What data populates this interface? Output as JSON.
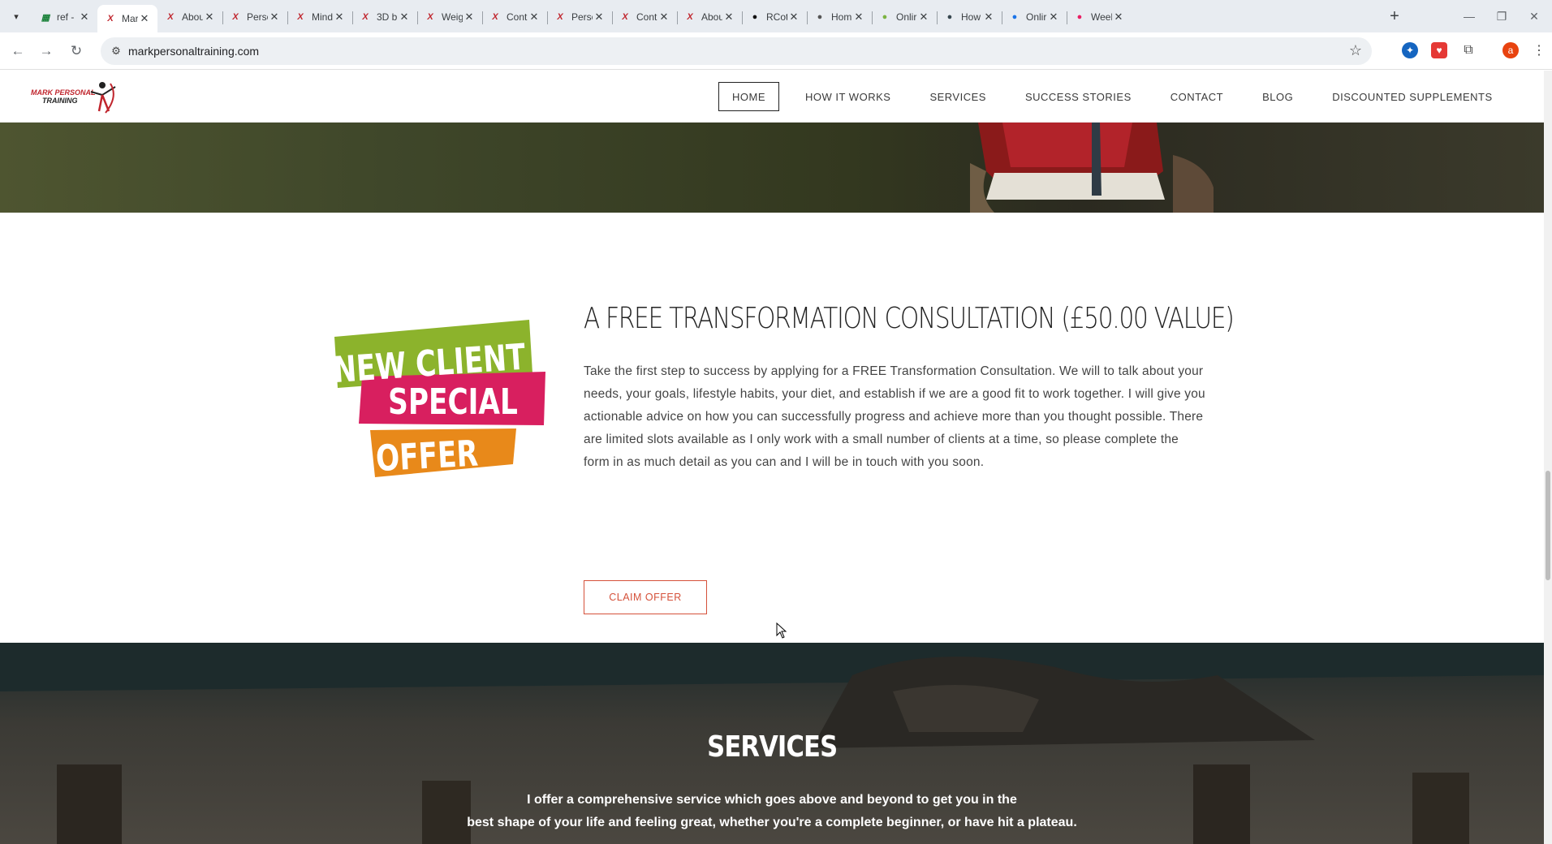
{
  "browser": {
    "tabs": [
      {
        "title": "ref -",
        "favicon": "sheets-icon",
        "color": "#188038",
        "active": false
      },
      {
        "title": "Mark",
        "favicon": "mark-logo-icon",
        "color": "#c0252d",
        "active": true
      },
      {
        "title": "Abou",
        "favicon": "mark-logo-icon",
        "color": "#c0252d",
        "active": false
      },
      {
        "title": "Perso",
        "favicon": "mark-logo-icon",
        "color": "#c0252d",
        "active": false
      },
      {
        "title": "Mind",
        "favicon": "mark-logo-icon",
        "color": "#c0252d",
        "active": false
      },
      {
        "title": "3D b",
        "favicon": "mark-logo-icon",
        "color": "#c0252d",
        "active": false
      },
      {
        "title": "Weig",
        "favicon": "mark-logo-icon",
        "color": "#c0252d",
        "active": false
      },
      {
        "title": "Cont",
        "favicon": "mark-logo-icon",
        "color": "#c0252d",
        "active": false
      },
      {
        "title": "Perso",
        "favicon": "mark-logo-icon",
        "color": "#c0252d",
        "active": false
      },
      {
        "title": "Cont",
        "favicon": "mark-logo-icon",
        "color": "#c0252d",
        "active": false
      },
      {
        "title": "Abou",
        "favicon": "mark-logo-icon",
        "color": "#c0252d",
        "active": false
      },
      {
        "title": "RCot",
        "favicon": "rcot-icon",
        "color": "#111111",
        "active": false
      },
      {
        "title": "Hom",
        "favicon": "home-site-icon",
        "color": "#555555",
        "active": false
      },
      {
        "title": "Onlir",
        "favicon": "online-site-icon",
        "color": "#7cb342",
        "active": false
      },
      {
        "title": "How",
        "favicon": "how-site-icon",
        "color": "#37474f",
        "active": false
      },
      {
        "title": "Onlir",
        "favicon": "p-site-icon",
        "color": "#1a73e8",
        "active": false
      },
      {
        "title": "Weel",
        "favicon": "week-site-icon",
        "color": "#e91e63",
        "active": false
      }
    ],
    "url": "markpersonaltraining.com",
    "profile_initial": "a"
  },
  "site": {
    "logo": {
      "line1": "MARK PERSONAL",
      "line2": "TRAINING"
    },
    "nav": [
      {
        "label": "HOME",
        "active": true
      },
      {
        "label": "HOW IT WORKS",
        "active": false
      },
      {
        "label": "SERVICES",
        "active": false
      },
      {
        "label": "SUCCESS STORIES",
        "active": false
      },
      {
        "label": "CONTACT",
        "active": false
      },
      {
        "label": "BLOG",
        "active": false
      },
      {
        "label": "DISCOUNTED SUPPLEMENTS",
        "active": false
      }
    ],
    "offer": {
      "badge": {
        "line1": "NEW CLIENT",
        "line2": "SPECIAL",
        "line3": "OFFER"
      },
      "title": "A FREE TRANSFORMATION CONSULTATION (£50.00 VALUE)",
      "body_lines": [
        "Take the first step to success by applying for a FREE Transformation Consultation. We will to talk about your",
        "needs, your goals, lifestyle habits, your diet, and establish if we are a good fit to work together. I will give you",
        "actionable advice on how you can successfully progress and achieve more than you thought possible. There",
        "are limited slots available as I only work with a small number of clients at a time, so please complete the",
        "form in as much detail as you can and I will be in touch with you soon."
      ],
      "button": "CLAIM OFFER"
    },
    "services": {
      "title": "SERVICES",
      "text_line1": "I offer a comprehensive service which goes above and beyond to get you in the",
      "text_line2": "best shape of your life and feeling great, whether you're a complete beginner, or have hit a plateau."
    },
    "colors": {
      "accent": "#d5513a",
      "badge_green": "#8cb32c",
      "badge_pink": "#d81f5f",
      "badge_orange": "#e8891a"
    }
  }
}
